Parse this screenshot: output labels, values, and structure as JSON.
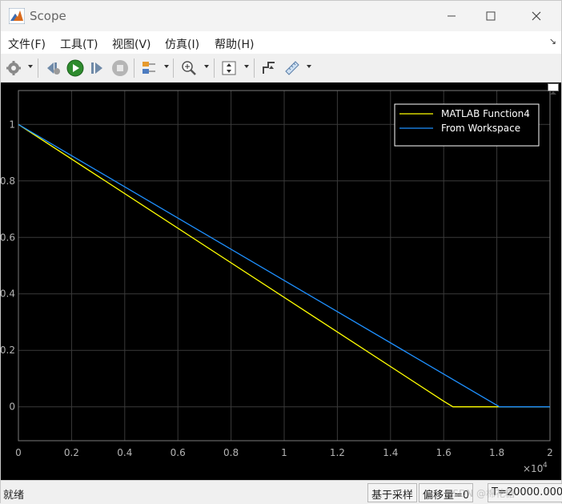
{
  "window": {
    "title": "Scope"
  },
  "menu": {
    "items": [
      "文件(F)",
      "工具(T)",
      "视图(V)",
      "仿真(I)",
      "帮助(H)"
    ],
    "overflow_icon": "dock-arrow-icon"
  },
  "toolbar": {
    "buttons": [
      "settings-icon",
      "step-back-icon",
      "run-icon",
      "step-forward-icon",
      "stop-icon",
      "signal-tools-icon",
      "zoom-in-icon",
      "autoscale-icon",
      "triggers-icon",
      "cursor-measure-icon"
    ]
  },
  "colors": {
    "plot_background": "#000000",
    "axes_panel": "#000000",
    "tick_label": "#b4b4b4",
    "grid": "#3a3a3a",
    "series_yellow": "#ffff00",
    "series_blue": "#1e90ff",
    "legend_border": "#ffffff"
  },
  "chart_data": {
    "type": "line",
    "title": "",
    "xlabel": "",
    "ylabel": "",
    "xlim": [
      0,
      20000
    ],
    "ylim": [
      -0.12,
      1.12
    ],
    "x_tick_values": [
      0,
      2000,
      4000,
      6000,
      8000,
      10000,
      12000,
      14000,
      16000,
      18000,
      20000
    ],
    "x_tick_labels": [
      "0",
      "0.2",
      "0.4",
      "0.6",
      "0.8",
      "1",
      "1.2",
      "1.4",
      "1.6",
      "1.8",
      "2"
    ],
    "x_exponent": "×10",
    "x_exponent_power": "4",
    "y_tick_values": [
      0,
      0.2,
      0.4,
      0.6,
      0.8,
      1
    ],
    "y_tick_labels": [
      "0",
      "0.2",
      "0.4",
      "0.6",
      "0.8",
      "1"
    ],
    "grid": true,
    "legend_position": "top-right",
    "series": [
      {
        "name": "MATLAB Function4",
        "color": "#ffff00",
        "x": [
          0,
          16000,
          16350,
          20000
        ],
        "y": [
          1,
          0.02,
          0,
          0
        ]
      },
      {
        "name": "From Workspace",
        "color": "#1e90ff",
        "x": [
          0,
          18100,
          20000
        ],
        "y": [
          1,
          0,
          0
        ]
      }
    ]
  },
  "status": {
    "ready": "就绪",
    "mode": "基于采样",
    "offset": "偏移量=0",
    "time": "T=20000.000"
  },
  "watermark": "CSDN @棉花糖"
}
